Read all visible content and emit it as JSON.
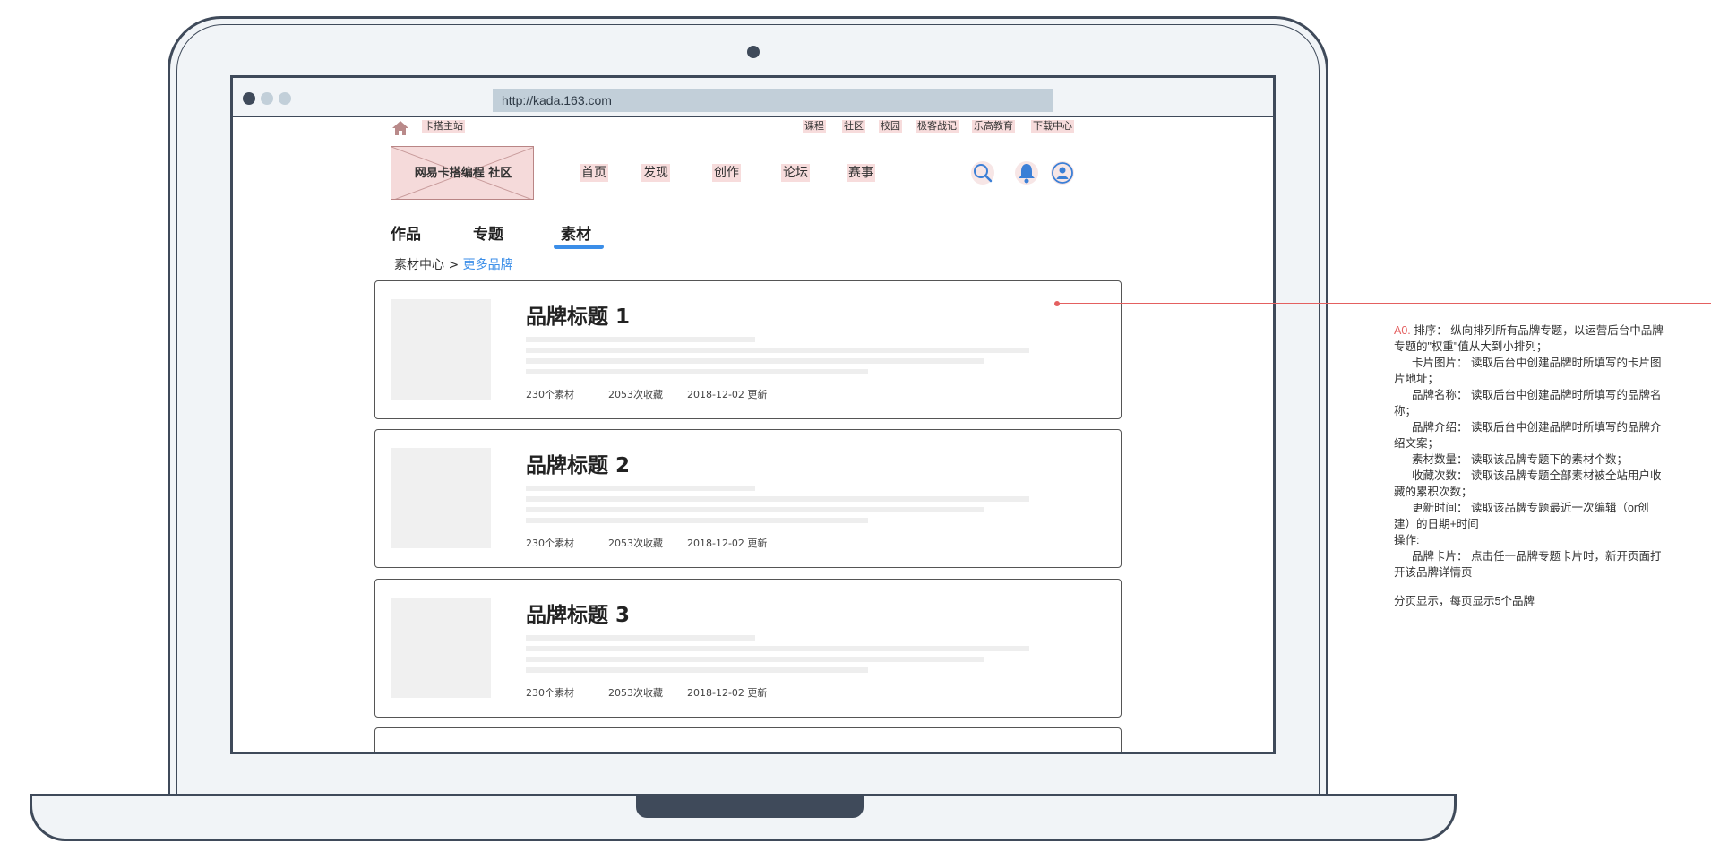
{
  "browser": {
    "url": "http://kada.163.com"
  },
  "topbar": {
    "home_label": "卡搭主站",
    "links": [
      "课程",
      "社区",
      "校园",
      "极客战记",
      "乐高教育",
      "下载中心"
    ]
  },
  "header": {
    "logo_text": "网易卡搭编程  社区",
    "nav": [
      "首页",
      "发现",
      "创作",
      "论坛",
      "赛事"
    ]
  },
  "tabs": {
    "items": [
      "作品",
      "专题",
      "素材"
    ],
    "active": "素材"
  },
  "breadcrumb": {
    "root": "素材中心",
    "separator": " > ",
    "current": "更多品牌"
  },
  "cards": [
    {
      "title": "品牌标题 1",
      "count": "230个素材",
      "favorites": "2053次收藏",
      "updated": "2018-12-02 更新"
    },
    {
      "title": "品牌标题 2",
      "count": "230个素材",
      "favorites": "2053次收藏",
      "updated": "2018-12-02 更新"
    },
    {
      "title": "品牌标题 3",
      "count": "230个素材",
      "favorites": "2053次收藏",
      "updated": "2018-12-02 更新"
    }
  ],
  "notes": {
    "tag": "A0.",
    "lines": [
      "排序： 纵向排列所有品牌专题，以运营后台中品牌专题的\"权重\"值从大到小排列；",
      "卡片图片： 读取后台中创建品牌时所填写的卡片图片地址；",
      "品牌名称： 读取后台中创建品牌时所填写的品牌名称；",
      "品牌介绍： 读取后台中创建品牌时所填写的品牌介绍文案；",
      "素材数量： 读取该品牌专题下的素材个数；",
      "收藏次数： 读取该品牌专题全部素材被全站用户收藏的累积次数；",
      "更新时间： 读取该品牌专题最近一次编辑（or创建）的日期+时间",
      "操作:",
      "品牌卡片： 点击任一品牌专题卡片时，新开页面打开该品牌详情页",
      "分页显示，每页显示5个品牌"
    ]
  },
  "colors": {
    "accent": "#3b8ee8",
    "annotation": "#e46060",
    "frame": "#3f4a5a"
  }
}
